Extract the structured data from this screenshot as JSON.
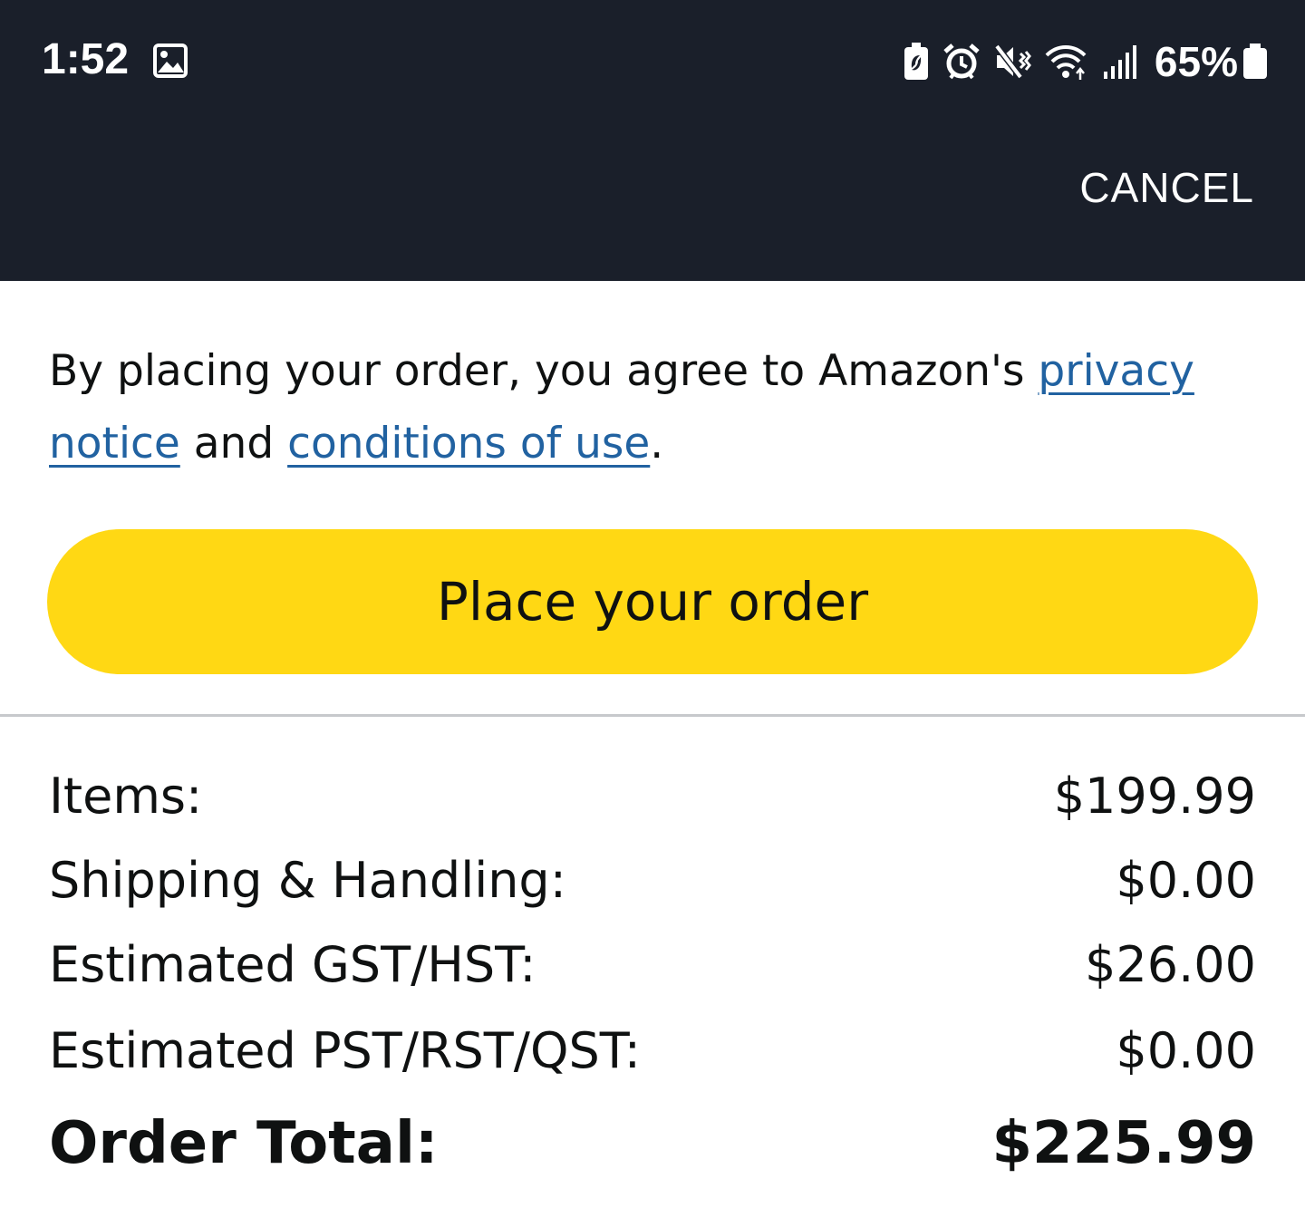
{
  "status_bar": {
    "time": "1:52",
    "battery_percent": "65%",
    "icons_left": [
      "gallery-icon"
    ],
    "icons_right": [
      "battery-saver-icon",
      "alarm-icon",
      "mute-icon",
      "wifi-icon",
      "signal-icon",
      "battery-icon"
    ]
  },
  "header": {
    "cancel_label": "CANCEL",
    "background_color": "#1a1f2a"
  },
  "agreement": {
    "prefix": "By placing your order, you agree to Amazon's ",
    "privacy_link": "privacy notice",
    "middle": " and ",
    "conditions_link": "conditions of use",
    "suffix": ".",
    "link_color": "#2162a1"
  },
  "place_order_button": {
    "label": "Place your order",
    "color": "#ffd814"
  },
  "summary": {
    "items_label": "Items:",
    "items_value": "$199.99",
    "shipping_label": "Shipping & Handling:",
    "shipping_value": "$0.00",
    "gst_label": "Estimated GST/HST:",
    "gst_value": "$26.00",
    "pst_label": "Estimated PST/RST/QST:",
    "pst_value": "$0.00",
    "total_label": "Order Total:",
    "total_value": "$225.99"
  }
}
